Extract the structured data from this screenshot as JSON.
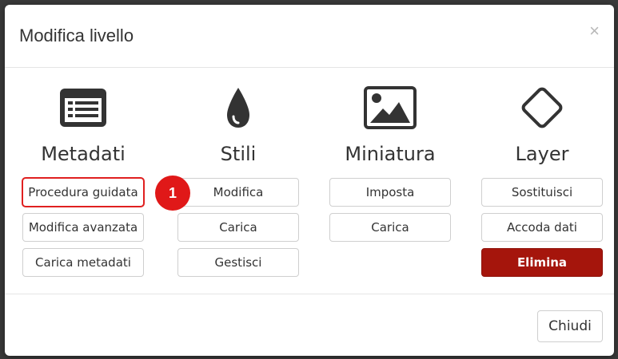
{
  "dialog": {
    "title": "Modifica livello",
    "close_symbol": "×",
    "footer_close_label": "Chiudi"
  },
  "columns": [
    {
      "heading": "Metadati",
      "icon": "list-box-icon",
      "buttons": [
        "Procedura guidata",
        "Modifica avanzata",
        "Carica metadati"
      ]
    },
    {
      "heading": "Stili",
      "icon": "droplet-icon",
      "buttons": [
        "Modifica",
        "Carica",
        "Gestisci"
      ]
    },
    {
      "heading": "Miniatura",
      "icon": "image-icon",
      "buttons": [
        "Imposta",
        "Carica"
      ]
    },
    {
      "heading": "Layer",
      "icon": "diamond-icon",
      "buttons": [
        "Sostituisci",
        "Accoda dati",
        "Elimina"
      ]
    }
  ],
  "annotation": {
    "badge_text": "1",
    "color": "#e01818"
  },
  "colors": {
    "danger": "#a5150c"
  }
}
